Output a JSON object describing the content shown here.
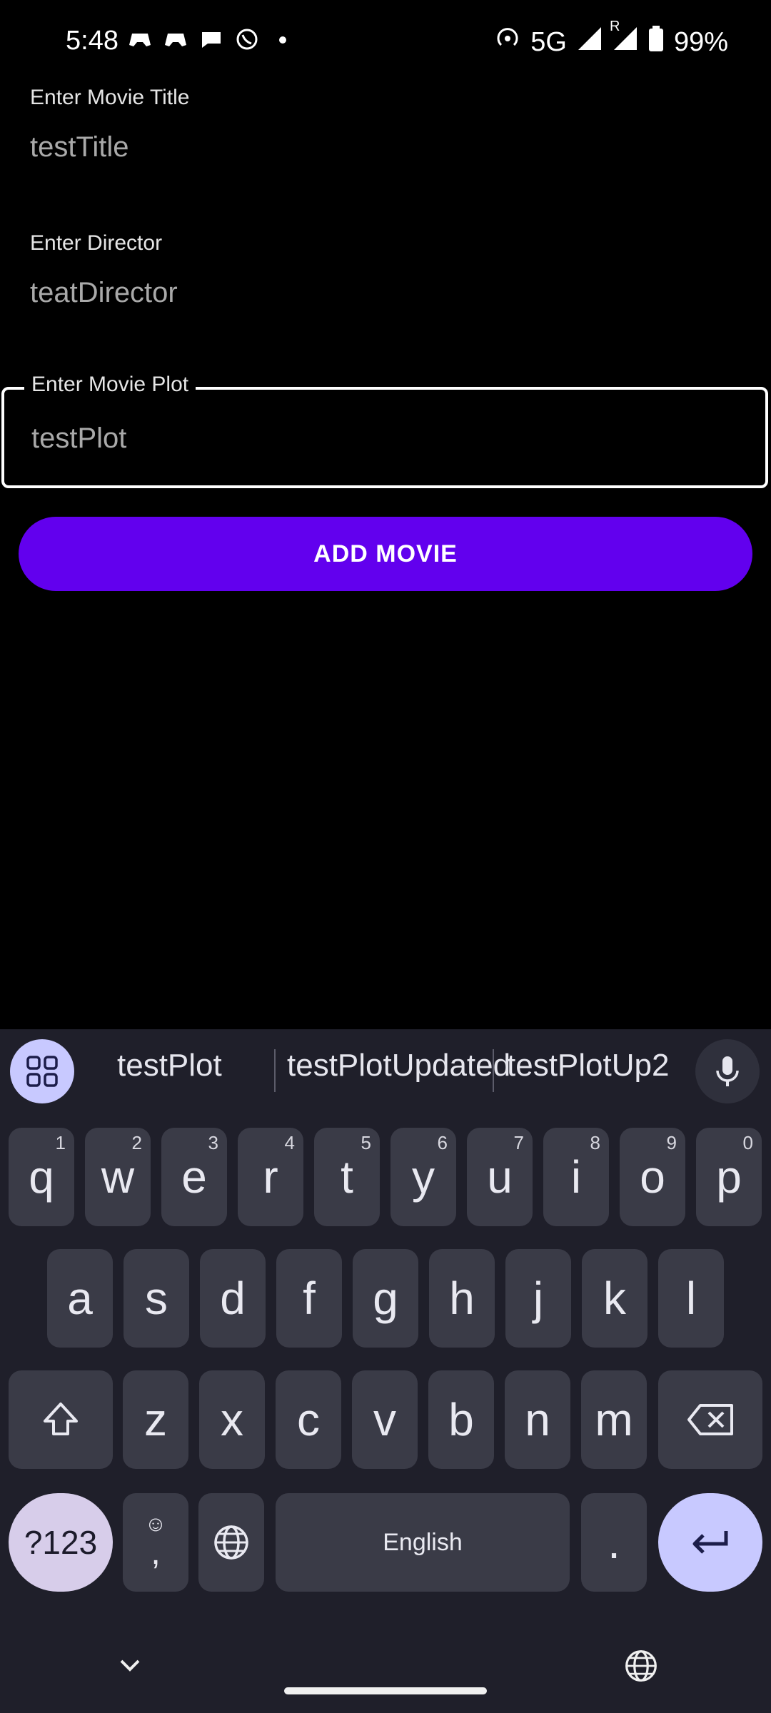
{
  "status_bar": {
    "time": "5:48",
    "network": "5G",
    "roaming": "R",
    "battery": "99%"
  },
  "form": {
    "title": {
      "label": "Enter Movie Title",
      "value": "testTitle"
    },
    "director": {
      "label": "Enter Director",
      "value": "teatDirector"
    },
    "plot": {
      "label": "Enter Movie Plot",
      "value": "testPlot"
    },
    "add_button": "ADD MOVIE"
  },
  "keyboard": {
    "suggestions": [
      "testPlot",
      "testPlotUpdated",
      "testPlotUp2"
    ],
    "row1": [
      {
        "k": "q",
        "n": "1"
      },
      {
        "k": "w",
        "n": "2"
      },
      {
        "k": "e",
        "n": "3"
      },
      {
        "k": "r",
        "n": "4"
      },
      {
        "k": "t",
        "n": "5"
      },
      {
        "k": "y",
        "n": "6"
      },
      {
        "k": "u",
        "n": "7"
      },
      {
        "k": "i",
        "n": "8"
      },
      {
        "k": "o",
        "n": "9"
      },
      {
        "k": "p",
        "n": "0"
      }
    ],
    "row2": [
      "a",
      "s",
      "d",
      "f",
      "g",
      "h",
      "j",
      "k",
      "l"
    ],
    "row3": [
      "z",
      "x",
      "c",
      "v",
      "b",
      "n",
      "m"
    ],
    "symbols_label": "?123",
    "comma_label": ",",
    "space_label": "English",
    "period_label": "."
  },
  "colors": {
    "accent": "#6200ee",
    "keyboard_bg": "#1f1f2a",
    "key_bg": "#3a3b47",
    "enter_bg": "#c8c9ff"
  }
}
